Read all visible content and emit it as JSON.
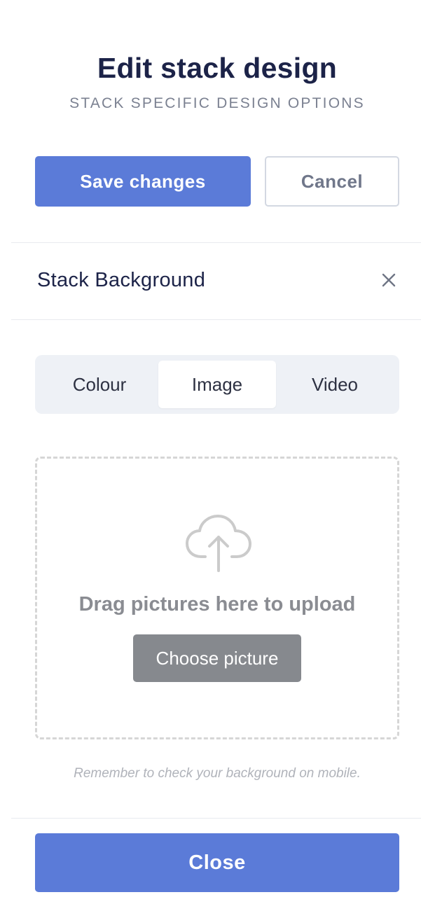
{
  "header": {
    "title": "Edit stack design",
    "subtitle": "STACK SPECIFIC DESIGN OPTIONS"
  },
  "actions": {
    "save_label": "Save changes",
    "cancel_label": "Cancel"
  },
  "section": {
    "title": "Stack Background",
    "close_icon": "close-icon"
  },
  "tabs": {
    "items": [
      {
        "label": "Colour",
        "selected": false
      },
      {
        "label": "Image",
        "selected": true
      },
      {
        "label": "Video",
        "selected": false
      }
    ]
  },
  "upload": {
    "icon": "cloud-upload-icon",
    "drag_text": "Drag pictures here to upload",
    "choose_label": "Choose picture"
  },
  "reminder": "Remember to check your background on mobile.",
  "footer": {
    "close_label": "Close"
  },
  "colors": {
    "primary": "#5b7bd8",
    "title": "#1c2348",
    "muted": "#7b8191",
    "tab_bg": "#eef1f6",
    "choose_bg": "#86898e"
  }
}
